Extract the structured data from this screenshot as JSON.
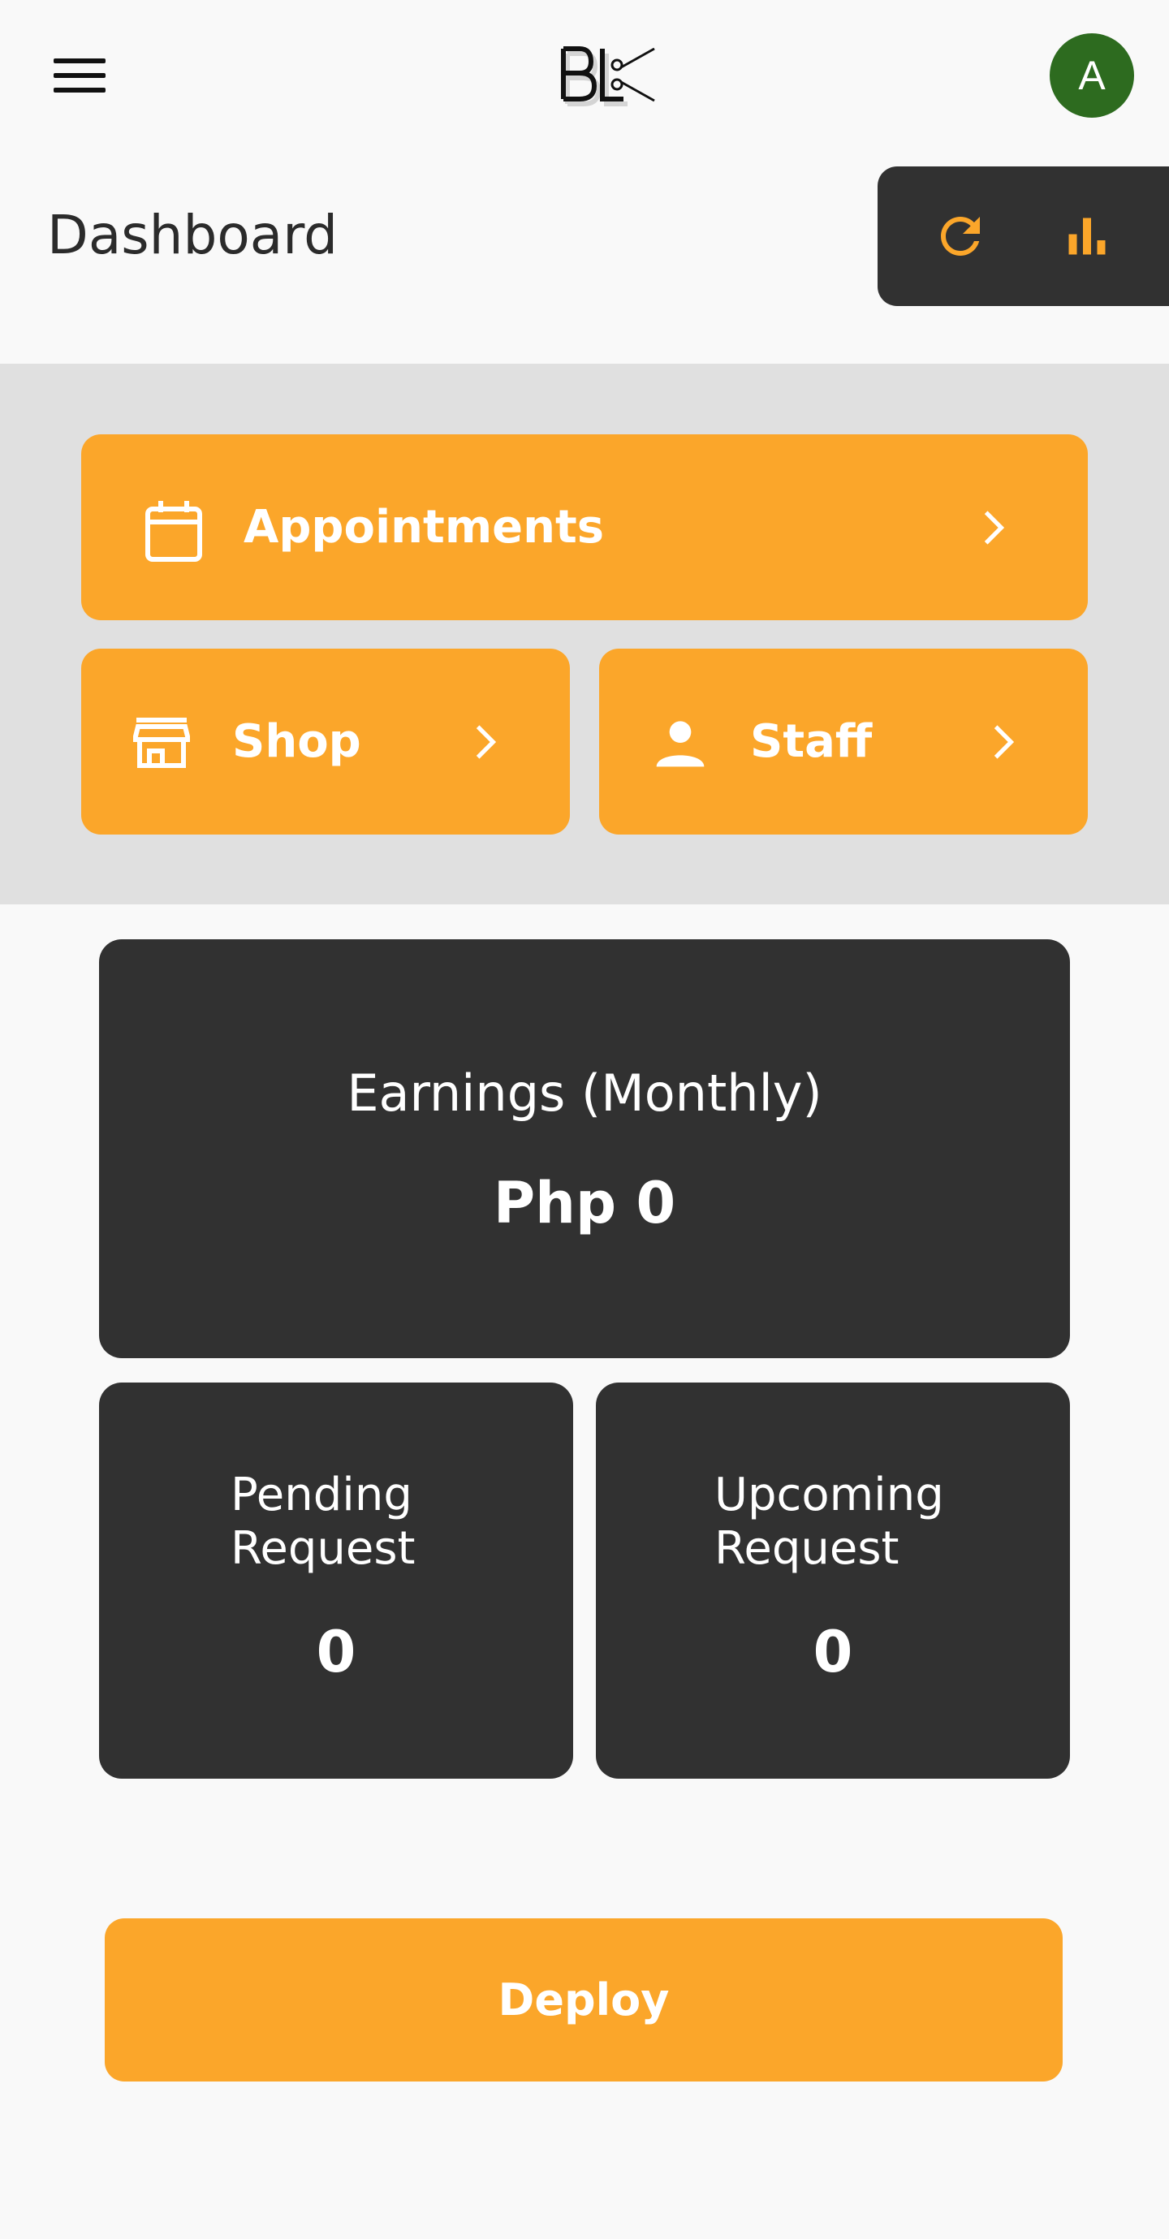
{
  "header": {
    "logo_text": "BLX",
    "avatar_initial": "A",
    "menu_icon": "hamburger-icon"
  },
  "title": "Dashboard",
  "actions": {
    "refresh_icon": "refresh-icon",
    "stats_icon": "bar-chart-icon"
  },
  "colors": {
    "accent": "#fba62a",
    "dark_card": "#313131",
    "avatar": "#2d6b1f",
    "nav_background": "#e0e0e0"
  },
  "quick_nav": {
    "appointments": {
      "label": "Appointments",
      "icon": "calendar-icon"
    },
    "shop": {
      "label": "Shop",
      "icon": "store-icon"
    },
    "staff": {
      "label": "Staff",
      "icon": "person-icon"
    }
  },
  "stats": {
    "earnings": {
      "label": "Earnings (Monthly)",
      "value": "Php 0"
    },
    "pending": {
      "label_line1": "Pending",
      "label_line2": "Request",
      "value": "0"
    },
    "upcoming": {
      "label_line1": "Upcoming",
      "label_line2": "Request",
      "value": "0"
    }
  },
  "deploy_label": "Deploy"
}
